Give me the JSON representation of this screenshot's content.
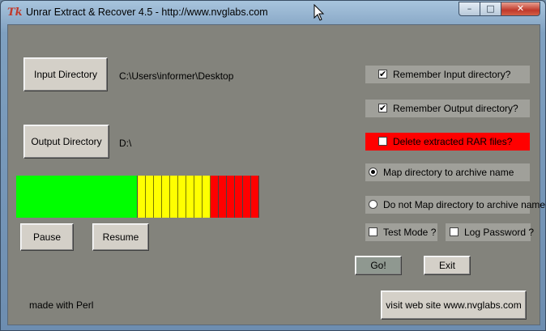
{
  "window": {
    "title": "Unrar Extract & Recover 4.5 - http://www.nvglabs.com",
    "icon": "Tk"
  },
  "buttons": {
    "input_directory": "Input Directory",
    "output_directory": "Output Directory",
    "pause": "Pause",
    "resume": "Resume",
    "go": "Go!",
    "exit": "Exit",
    "visit": "visit web site www.nvglabs.com"
  },
  "paths": {
    "input": "C:\\Users\\informer\\Desktop",
    "output": "D:\\"
  },
  "options": {
    "remember_input": {
      "label": "Remember Input directory?",
      "checked": true
    },
    "remember_output": {
      "label": "Remember Output directory?",
      "checked": true
    },
    "delete_rar": {
      "label": "Delete extracted RAR files?",
      "checked": false,
      "highlight": "#ff0000"
    },
    "map_dir": {
      "label": "Map directory to archive name",
      "selected": true
    },
    "no_map_dir": {
      "label": "Do not Map directory to archive name",
      "selected": false
    },
    "test_mode": {
      "label": "Test Mode ?",
      "checked": false
    },
    "log_password": {
      "label": "Log Password ?",
      "checked": false
    }
  },
  "progress": {
    "segments": {
      "green": 15,
      "yellow": 9,
      "red": 6
    },
    "colors": {
      "green": "#00ff00",
      "yellow": "#ffff00",
      "red": "#ff0000"
    }
  },
  "footer": {
    "credit": "made with Perl"
  },
  "checkmark": "✔"
}
